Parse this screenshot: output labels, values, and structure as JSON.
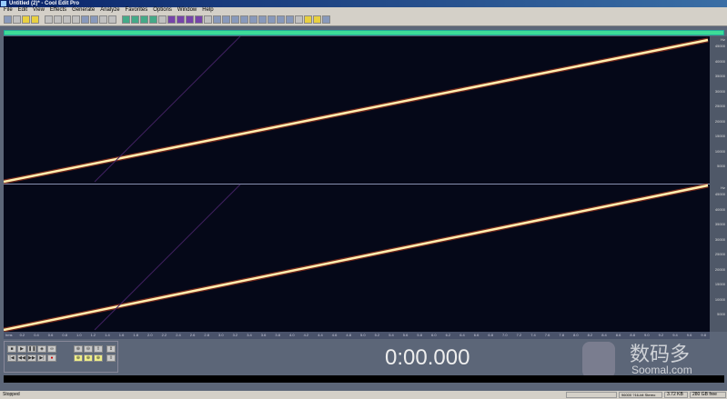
{
  "window": {
    "title": "Untitled (2)* - Cool Edit Pro"
  },
  "menu": [
    "File",
    "Edit",
    "View",
    "Effects",
    "Generate",
    "Analyze",
    "Favorites",
    "Options",
    "Window",
    "Help"
  ],
  "axis": {
    "unit": "Hz",
    "labels": [
      "45000",
      "40000",
      "35000",
      "30000",
      "25000",
      "20000",
      "15000",
      "10000",
      "5000"
    ]
  },
  "ruler": {
    "labels": [
      "hms",
      "0.2",
      "0.4",
      "0.6",
      "0.8",
      "1.0",
      "1.2",
      "1.4",
      "1.6",
      "1.8",
      "2.0",
      "2.2",
      "2.4",
      "2.6",
      "2.8",
      "3.0",
      "3.2",
      "3.4",
      "3.6",
      "3.8",
      "4.0",
      "4.2",
      "4.4",
      "4.6",
      "4.8",
      "5.0",
      "5.2",
      "5.4",
      "5.6",
      "5.8",
      "6.0",
      "6.2",
      "6.4",
      "6.6",
      "6.8",
      "7.0",
      "7.2",
      "7.4",
      "7.6",
      "7.8",
      "8.0",
      "8.2",
      "8.4",
      "8.6",
      "8.8",
      "9.0",
      "9.2",
      "9.4",
      "9.6",
      "9.8"
    ]
  },
  "time_display": "0:00.000",
  "status": {
    "state": "Stopped",
    "format": "96000 ?16-bit Stereo",
    "size": "3.72 KB",
    "free": "280 GB free"
  },
  "watermark": {
    "text": "数码多",
    "domain": "Soomal.com"
  },
  "colors": {
    "overview": "#3ddc97",
    "spectrogram_bg": "#050818",
    "sweep": "#fff0b0"
  }
}
